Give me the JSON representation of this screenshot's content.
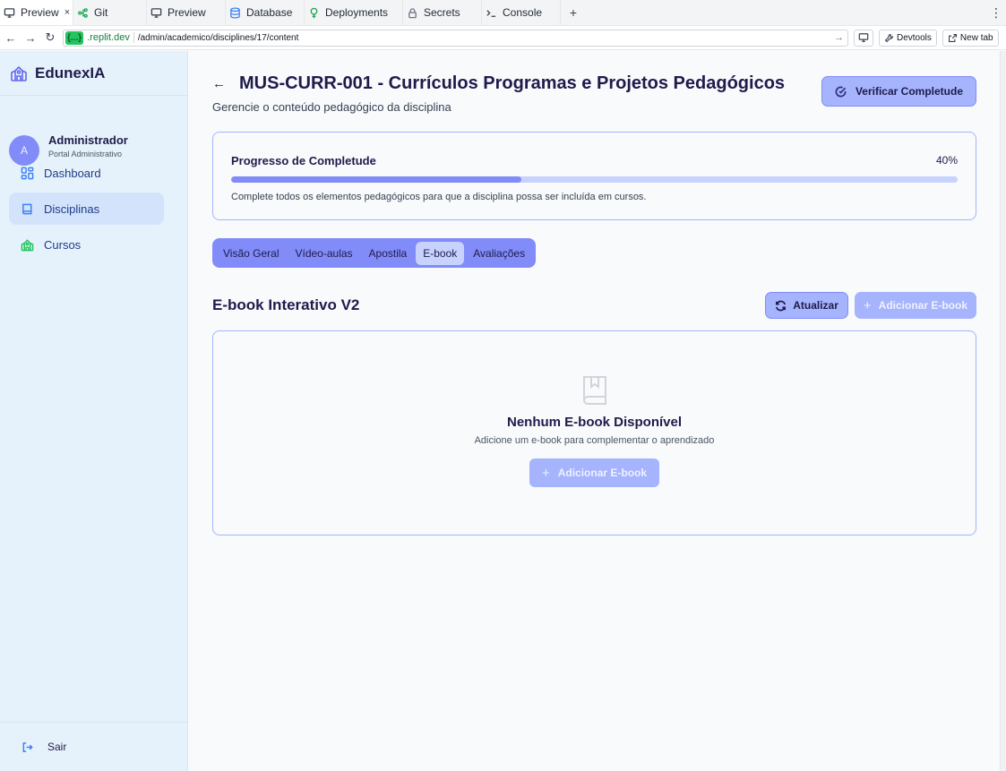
{
  "browser": {
    "tabs": [
      {
        "label": "Preview",
        "icon": "monitor-icon",
        "close": "×"
      },
      {
        "label": "Git",
        "icon": "git-icon"
      },
      {
        "label": "Preview",
        "icon": "monitor-icon"
      },
      {
        "label": "Database",
        "icon": "database-icon"
      },
      {
        "label": "Deployments",
        "icon": "deploy-icon"
      },
      {
        "label": "Secrets",
        "icon": "lock-icon"
      },
      {
        "label": "Console",
        "icon": "terminal-icon"
      }
    ],
    "new_tab_plus": "+",
    "menu": "⋮",
    "address": {
      "badge": "{...}",
      "domain": ".replit.dev",
      "path": "/admin/academico/disciplines/17/content",
      "go": "→"
    },
    "devtools_label": "Devtools",
    "new_tab_label": "New tab"
  },
  "sidebar": {
    "brand": "EdunexIA",
    "user": {
      "initial": "A",
      "name": "Administrador",
      "role": "Portal Administrativo"
    },
    "items": [
      {
        "label": "Dashboard",
        "icon": "grid-icon"
      },
      {
        "label": "Disciplinas",
        "icon": "book-icon",
        "active": true
      },
      {
        "label": "Cursos",
        "icon": "school-icon"
      }
    ],
    "logout": "Sair"
  },
  "header": {
    "back": "←",
    "title": "MUS-CURR-001 - Currículos Programas e Projetos Pedagógicos",
    "subtitle": "Gerencie o conteúdo pedagógico da disciplina",
    "verify_button": "Verificar Completude"
  },
  "progress": {
    "label": "Progresso de Completude",
    "percent_text": "40%",
    "value": 0.4,
    "note": "Complete todos os elementos pedagógicos para que a disciplina possa ser incluída em cursos."
  },
  "tabs": [
    {
      "label": "Visão Geral"
    },
    {
      "label": "Vídeo-aulas"
    },
    {
      "label": "Apostila"
    },
    {
      "label": "E-book",
      "active": true
    },
    {
      "label": "Avaliações"
    }
  ],
  "section": {
    "title": "E-book Interativo V2",
    "refresh_button": "Atualizar",
    "add_button": "Adicionar E-book",
    "plus": "+"
  },
  "empty_state": {
    "title": "Nenhum E-book Disponível",
    "subtitle": "Adicione um e-book para complementar o aprendizado",
    "button": "Adicionar E-book",
    "plus": "+"
  },
  "colors": {
    "accent": "#818cf8",
    "accent_light": "#a5b4fc",
    "sidebar_bg": "#e6f2fb",
    "text_dark": "#1e1b4b"
  }
}
